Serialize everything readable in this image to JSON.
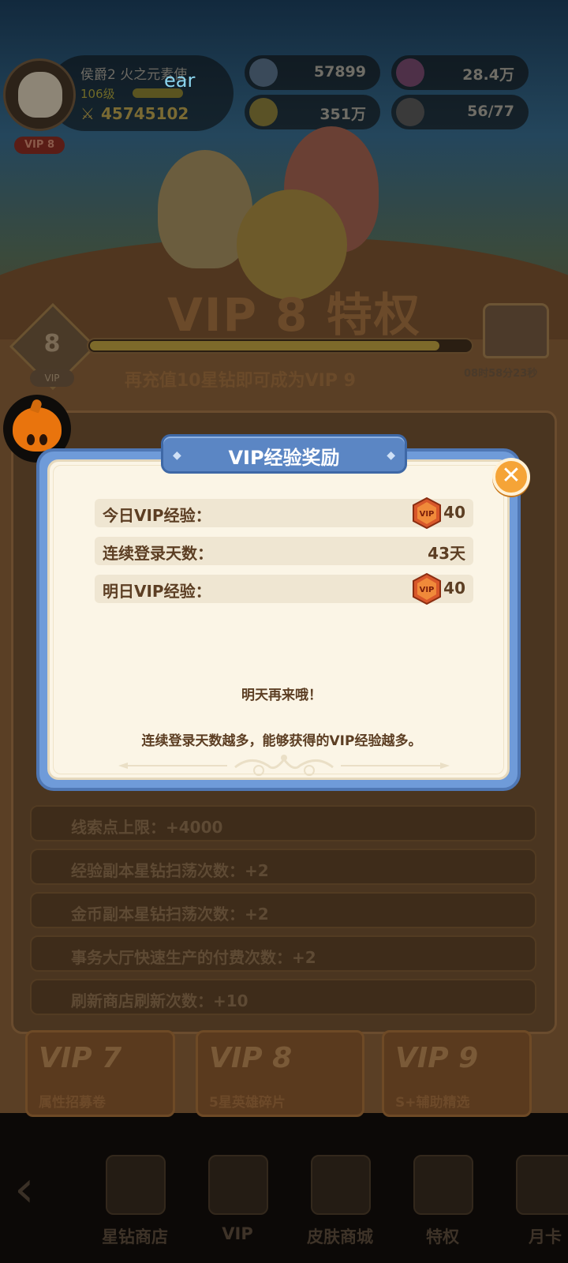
{
  "player": {
    "name": "侯爵2 火之元素使",
    "level": "106级",
    "power": "45745102",
    "vip": "VIP 8",
    "overlay_text": "ear"
  },
  "resources": [
    {
      "icon": "star-gem-icon",
      "value": "57899"
    },
    {
      "icon": "stamina-clock-icon",
      "value": "28.4万"
    },
    {
      "icon": "gold-coin-icon",
      "value": "351万"
    },
    {
      "icon": "friends-icon",
      "value": "56/77"
    }
  ],
  "vip_page": {
    "title": "VIP 8 特权",
    "level": "8",
    "level_tag": "VIP",
    "progress_fraction": 0.92,
    "progress_text": "再充值10星钻即可成为VIP 9",
    "timer": "08时58分23秒"
  },
  "privileges": [
    "线索点上限：+4000",
    "经验副本星钻扫荡次数：+2",
    "金币副本星钻扫荡次数：+2",
    "事务大厅快速生产的付费次数：+2",
    "刷新商店刷新次数：+10"
  ],
  "reward_cards": [
    {
      "title": "VIP 7",
      "subtitle": "属性招募卷"
    },
    {
      "title": "VIP 8",
      "subtitle": "5星英雄碎片"
    },
    {
      "title": "VIP 9",
      "subtitle": "S+辅助精选"
    }
  ],
  "tabs": [
    {
      "label": "星钻商店",
      "icon": "gem-shop-icon"
    },
    {
      "label": "VIP",
      "icon": "vip-icon"
    },
    {
      "label": "皮肤商城",
      "icon": "skin-shop-icon"
    },
    {
      "label": "特权",
      "icon": "privilege-icon"
    },
    {
      "label": "月卡",
      "icon": "monthly-card-icon"
    }
  ],
  "modal": {
    "title": "VIP经验奖励",
    "close_label": "✕",
    "rows": [
      {
        "label": "今日VIP经验：",
        "value": "40",
        "has_icon": true
      },
      {
        "label": "连续登录天数：",
        "value": "43天",
        "has_icon": false
      },
      {
        "label": "明日VIP经验：",
        "value": "40",
        "has_icon": true
      }
    ],
    "vip_icon_text": "VIP",
    "message_1": "明天再来哦！",
    "message_2": "连续登录天数越多，能够获得的VIP经验越多。"
  },
  "colors": {
    "modal_frame": "#6f9bd9",
    "modal_paper": "#fbf5e6",
    "text_brown": "#5c3e23",
    "close_orange": "#f5a437",
    "vip_hex": "#d8572a"
  }
}
